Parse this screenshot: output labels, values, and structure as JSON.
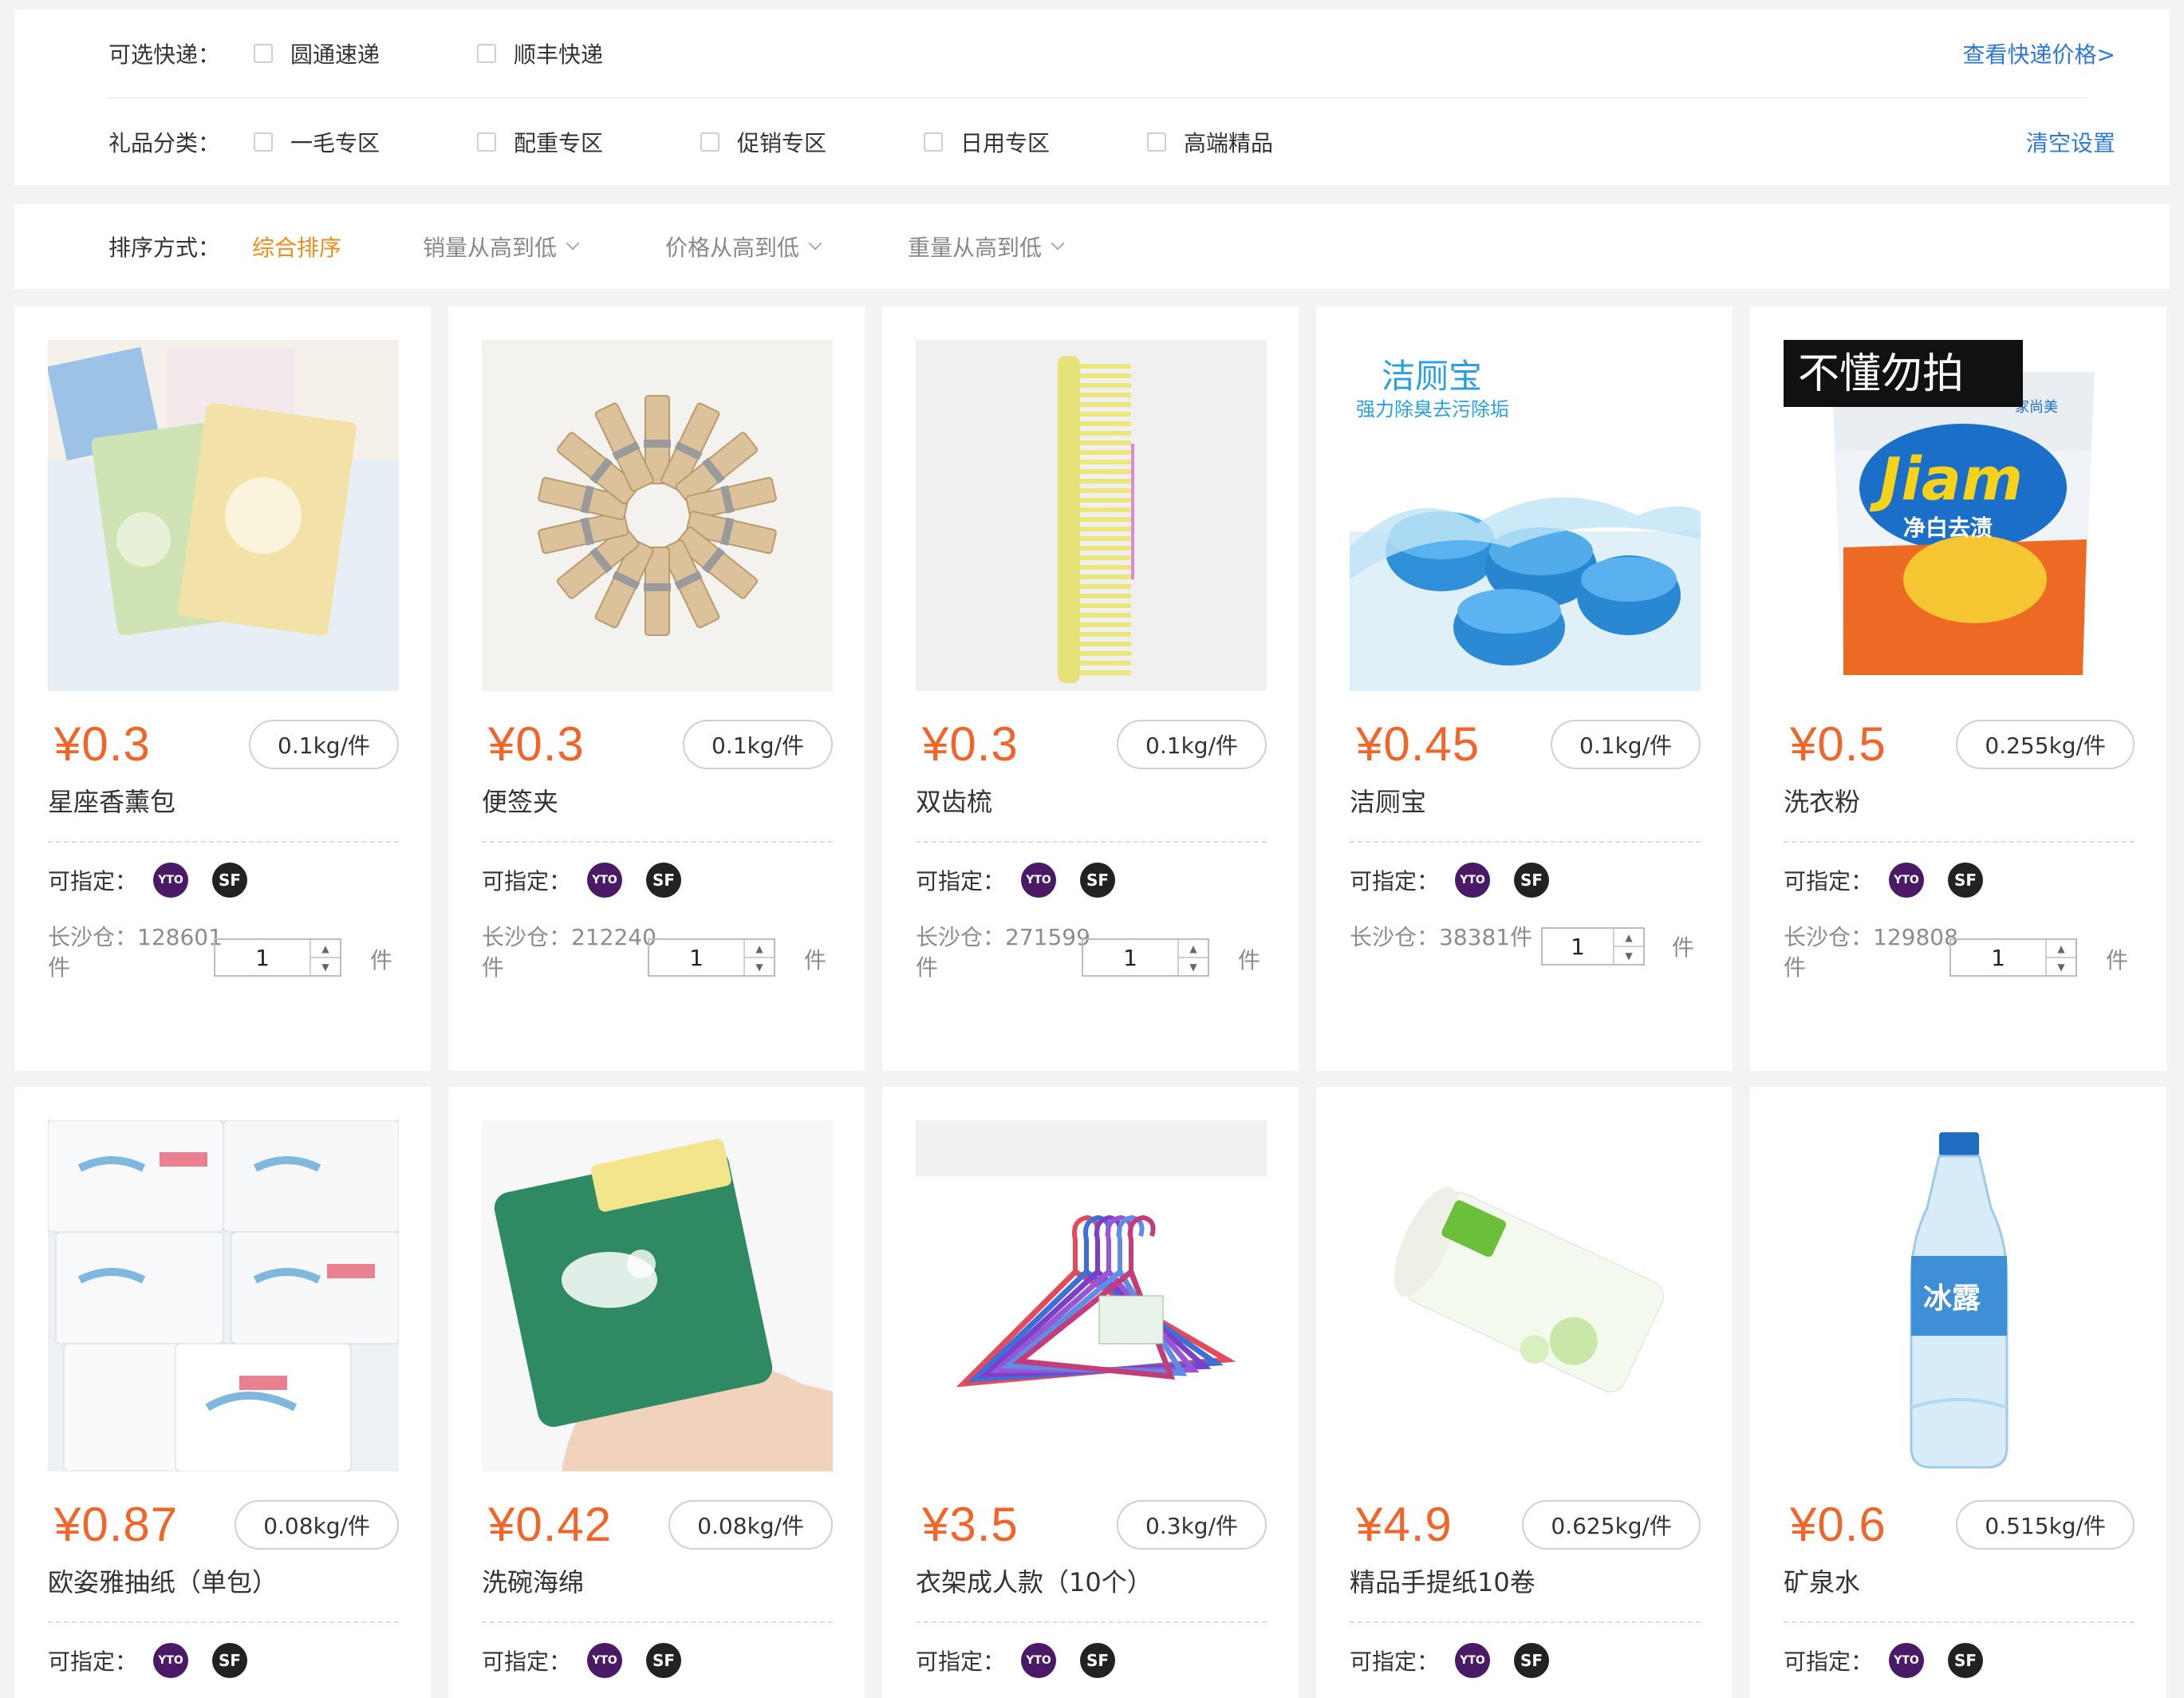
{
  "filters": {
    "express": {
      "label": "可选快递：",
      "options": [
        "圆通速递",
        "顺丰快递"
      ],
      "link": "查看快递价格>"
    },
    "category": {
      "label": "礼品分类：",
      "options": [
        "一毛专区",
        "配重专区",
        "促销专区",
        "日用专区",
        "高端精品"
      ],
      "link": "清空设置"
    }
  },
  "sort": {
    "label": "排序方式：",
    "items": [
      "综合排序",
      "销量从高到低",
      "价格从高到低",
      "重量从高到低"
    ],
    "active": "综合排序"
  },
  "colors": {
    "price": "#f2652a",
    "accent": "#f28b1a",
    "link": "#2d78d8",
    "yt_badge": "#4a1a66",
    "sf_badge": "#222222"
  },
  "card_common": {
    "assign_label": "可指定：",
    "badge_yt": "YTO",
    "badge_sf": "SF",
    "unit": "件",
    "up": "▲",
    "down": "▼"
  },
  "products": [
    {
      "name": "星座香薰包",
      "price": "¥0.3",
      "weight": "0.1kg/件",
      "stock": "长沙仓：128601件",
      "qty": "1",
      "image": "sachet"
    },
    {
      "name": "便签夹",
      "price": "¥0.3",
      "weight": "0.1kg/件",
      "stock": "长沙仓：212240件",
      "qty": "1",
      "image": "clips"
    },
    {
      "name": "双齿梳",
      "price": "¥0.3",
      "weight": "0.1kg/件",
      "stock": "长沙仓：271599件",
      "qty": "1",
      "image": "comb"
    },
    {
      "name": "洁厕宝",
      "price": "¥0.45",
      "weight": "0.1kg/件",
      "stock": "长沙仓：38381件",
      "qty": "1",
      "image": "toilet",
      "image_text": {
        "title": "洁厕宝",
        "subtitle": "强力除臭去污除垢"
      }
    },
    {
      "name": "洗衣粉",
      "price": "¥0.5",
      "weight": "0.255kg/件",
      "stock": "长沙仓：129808件",
      "qty": "1",
      "image": "detergent",
      "image_text": {
        "banner": "不懂勿拍",
        "brand": "Jiam",
        "slogan": "净白去渍",
        "maker": "家尚美"
      }
    },
    {
      "name": "欧姿雅抽纸（单包）",
      "price": "¥0.87",
      "weight": "0.08kg/件",
      "image": "tissue"
    },
    {
      "name": "洗碗海绵",
      "price": "¥0.42",
      "weight": "0.08kg/件",
      "image": "sponge"
    },
    {
      "name": "衣架成人款（10个）",
      "price": "¥3.5",
      "weight": "0.3kg/件",
      "image": "hangers"
    },
    {
      "name": "精品手提纸10卷",
      "price": "¥4.9",
      "weight": "0.625kg/件",
      "image": "rolls"
    },
    {
      "name": "矿泉水",
      "price": "¥0.6",
      "weight": "0.515kg/件",
      "image": "water",
      "image_text": {
        "label": "冰露"
      }
    }
  ]
}
